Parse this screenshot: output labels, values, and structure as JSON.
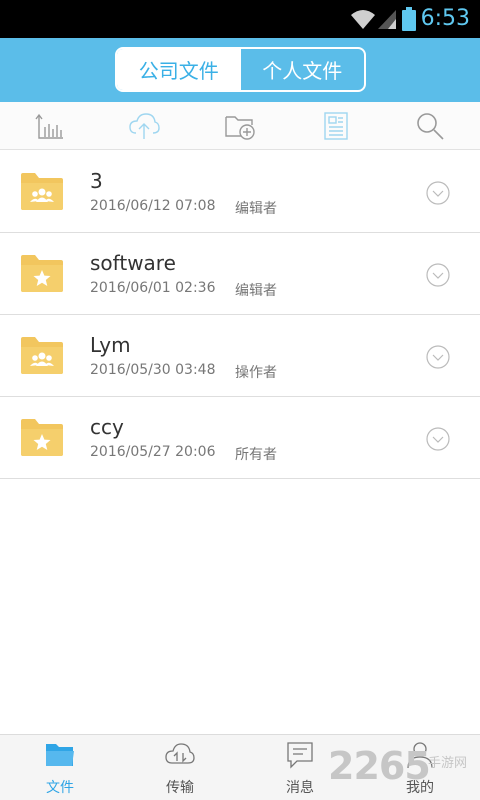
{
  "status_bar": {
    "time": "6:53"
  },
  "header": {
    "tabs": [
      {
        "label": "公司文件",
        "active": true
      },
      {
        "label": "个人文件",
        "active": false
      }
    ]
  },
  "toolbar": {
    "tools": [
      "sort-chart-icon",
      "upload-cloud-icon",
      "new-folder-icon",
      "document-icon",
      "search-icon"
    ]
  },
  "files": [
    {
      "name": "3",
      "date": "2016/06/12 07:08",
      "role": "编辑者",
      "icon": "shared-folder-icon"
    },
    {
      "name": "software",
      "date": "2016/06/01 02:36",
      "role": "编辑者",
      "icon": "star-folder-icon"
    },
    {
      "name": "Lym",
      "date": "2016/05/30 03:48",
      "role": "操作者",
      "icon": "shared-folder-icon"
    },
    {
      "name": "ccy",
      "date": "2016/05/27 20:06",
      "role": "所有者",
      "icon": "star-folder-icon"
    }
  ],
  "bottom_nav": {
    "items": [
      {
        "label": "文件",
        "active": true
      },
      {
        "label": "传输",
        "active": false
      },
      {
        "label": "消息",
        "active": false
      },
      {
        "label": "我的",
        "active": false
      }
    ]
  },
  "watermark": {
    "number": "2265",
    "text": "手游网"
  },
  "colors": {
    "accent": "#5bbde9",
    "folder": "#f2c65e",
    "active_tab": "#2fa5e6"
  }
}
